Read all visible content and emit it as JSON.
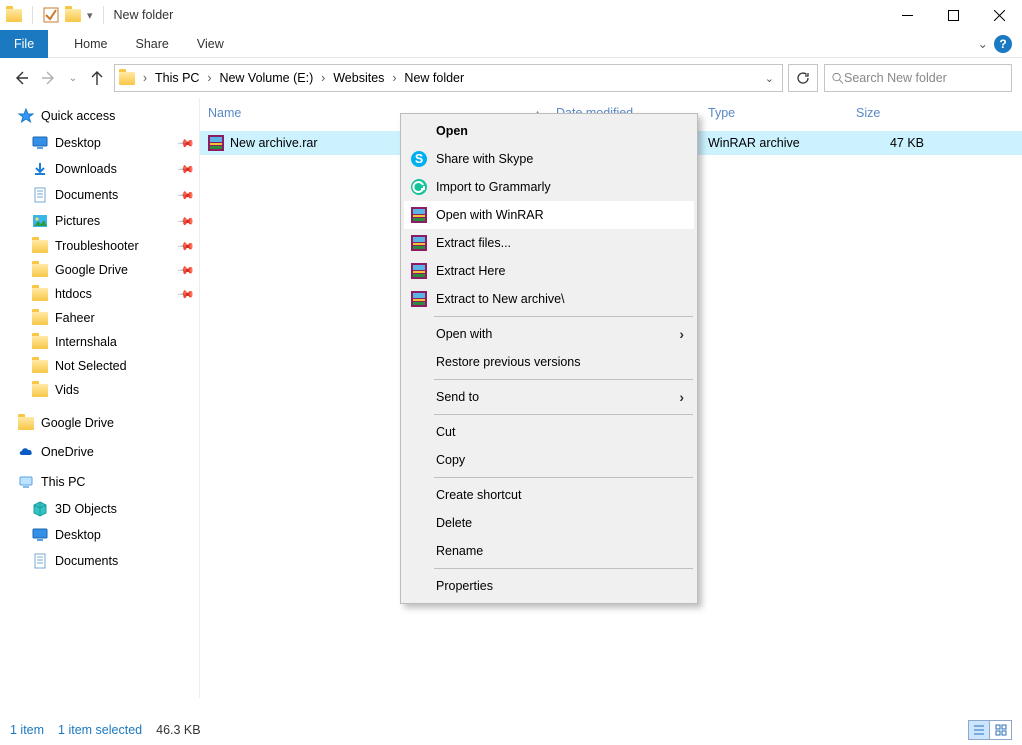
{
  "titlebar": {
    "title": "New folder"
  },
  "ribbon": {
    "file": "File",
    "tabs": [
      "Home",
      "Share",
      "View"
    ]
  },
  "breadcrumb": {
    "items": [
      "This PC",
      "New Volume (E:)",
      "Websites",
      "New folder"
    ]
  },
  "search": {
    "placeholder": "Search New folder"
  },
  "columns": {
    "name": "Name",
    "date": "Date modified",
    "type": "Type",
    "size": "Size"
  },
  "file_row": {
    "name": "New archive.rar",
    "type": "WinRAR archive",
    "size": "47 KB"
  },
  "nav": {
    "quick_access": "Quick access",
    "pinned": [
      {
        "label": "Desktop",
        "icon": "desktop"
      },
      {
        "label": "Downloads",
        "icon": "download"
      },
      {
        "label": "Documents",
        "icon": "document"
      },
      {
        "label": "Pictures",
        "icon": "pictures"
      },
      {
        "label": "Troubleshooter",
        "icon": "folder"
      },
      {
        "label": "Google Drive",
        "icon": "folder"
      },
      {
        "label": "htdocs",
        "icon": "folder"
      }
    ],
    "frequent": [
      {
        "label": "Faheer"
      },
      {
        "label": "Internshala"
      },
      {
        "label": "Not Selected"
      },
      {
        "label": "Vids"
      }
    ],
    "google_drive": "Google Drive",
    "onedrive": "OneDrive",
    "this_pc": "This PC",
    "this_pc_children": [
      {
        "label": "3D Objects",
        "icon": "3d"
      },
      {
        "label": "Desktop",
        "icon": "desktop"
      },
      {
        "label": "Documents",
        "icon": "document"
      }
    ]
  },
  "context_menu": {
    "open": "Open",
    "share_skype": "Share with Skype",
    "import_grammarly": "Import to Grammarly",
    "open_winrar": "Open with WinRAR",
    "extract_files": "Extract files...",
    "extract_here": "Extract Here",
    "extract_to": "Extract to New archive\\",
    "open_with": "Open with",
    "restore_versions": "Restore previous versions",
    "send_to": "Send to",
    "cut": "Cut",
    "copy": "Copy",
    "create_shortcut": "Create shortcut",
    "delete": "Delete",
    "rename": "Rename",
    "properties": "Properties"
  },
  "status": {
    "count": "1 item",
    "selected": "1 item selected",
    "size": "46.3 KB"
  }
}
